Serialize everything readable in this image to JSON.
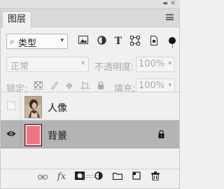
{
  "top_strip": {
    "collapse_glyph": "◂◂",
    "close_glyph": "✕"
  },
  "panel": {
    "tab_label": "图层",
    "menu_icon": "hamburger-icon"
  },
  "filter": {
    "kind_label": "类型",
    "icons": [
      "image-filter-icon",
      "adjustment-filter-icon",
      "type-filter-icon",
      "shape-filter-icon",
      "smart-object-filter-icon"
    ],
    "type_glyph": "T"
  },
  "blend": {
    "mode": "正常",
    "opacity_label": "不透明度:",
    "opacity_value": "100%"
  },
  "lock": {
    "label": "锁定:",
    "icons": [
      "lock-transparent-icon",
      "lock-paint-icon",
      "lock-move-icon",
      "lock-artboard-icon",
      "lock-all-icon"
    ],
    "fill_label": "填充:",
    "fill_value": "100%"
  },
  "layers": [
    {
      "name": "人像",
      "visible": false,
      "thumbnail": "portrait",
      "locked": false,
      "selected": false
    },
    {
      "name": "背景",
      "visible": true,
      "thumbnail_color": "#ef7483",
      "locked": true,
      "selected": true
    }
  ],
  "bottom_bar": {
    "icons": [
      "link-layers-icon",
      "fx-icon",
      "layer-mask-icon",
      "adjustment-layer-icon",
      "group-folder-icon",
      "new-layer-icon",
      "trash-icon"
    ],
    "fx_label": "fx"
  },
  "colors": {
    "panel_bg": "#f0f0f0",
    "selected_row": "#b4b4b4",
    "background_thumb": "#ef7483",
    "disabled_text": "#aaaaaa"
  }
}
